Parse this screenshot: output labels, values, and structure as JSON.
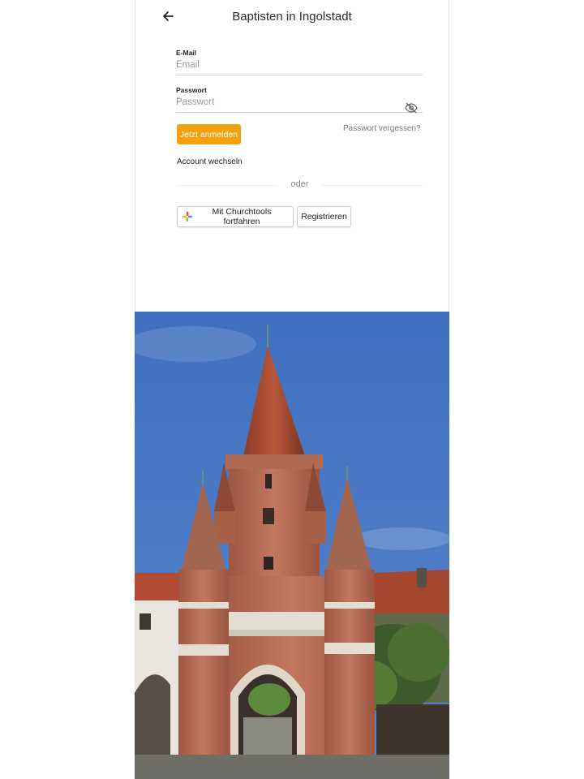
{
  "header": {
    "back_icon": "arrow-left-icon",
    "title": "Baptisten in Ingolstadt"
  },
  "login_form": {
    "email": {
      "label": "E-Mail",
      "placeholder": "Email",
      "value": ""
    },
    "password": {
      "label": "Passwort",
      "placeholder": "Passwort",
      "value": "",
      "toggle_icon": "eye-off-icon"
    },
    "submit_label": "Jetzt anmelden",
    "forgot_label": "Passwort vergessen?",
    "switch_account_label": "Account wechseln",
    "divider_label": "oder",
    "oauth_label": "Mit Churchtools fortfahren",
    "oauth_icon": "churchtools-logo-icon",
    "register_label": "Registrieren"
  },
  "hero_image": {
    "subject": "brick-gate-tower-photo"
  },
  "colors": {
    "accent": "#f7a00e",
    "sky": "#4a78c4",
    "brick": "#b5654a"
  }
}
